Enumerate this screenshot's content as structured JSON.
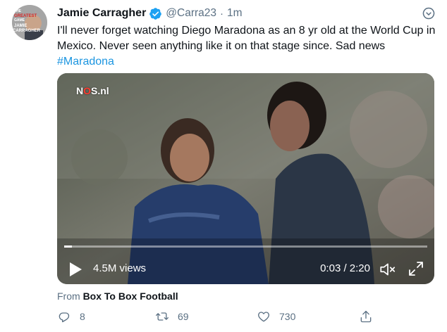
{
  "tweet": {
    "display_name": "Jamie Carragher",
    "handle": "@Carra23",
    "separator": "·",
    "time": "1m",
    "text_main": "I'll never forget watching Diego Maradona as an 8 yr old at the World Cup in Mexico. Never seen anything like it on that stage since. Sad news",
    "hashtag": "#Maradona",
    "avatar_text": [
      "THE",
      "GREATEST",
      "GAME",
      "JAMIE",
      "CARRAGHER"
    ]
  },
  "video": {
    "watermark_pre": "N",
    "watermark_o": "O",
    "watermark_post": "S.nl",
    "views": "4.5M views",
    "timecode": "0:03 / 2:20",
    "progress": 0.021
  },
  "source": {
    "prefix": "From",
    "name": "Box To Box Football"
  },
  "actions": {
    "replies": "8",
    "retweets": "69",
    "likes": "730"
  },
  "colors": {
    "link": "#1b95e0",
    "secondary_text": "#5b7083",
    "verified": "#1da1f2"
  },
  "icons": [
    "verified-icon",
    "caret-down-icon",
    "play-icon",
    "mute-icon",
    "fullscreen-icon",
    "reply-icon",
    "retweet-icon",
    "like-icon",
    "share-icon"
  ]
}
